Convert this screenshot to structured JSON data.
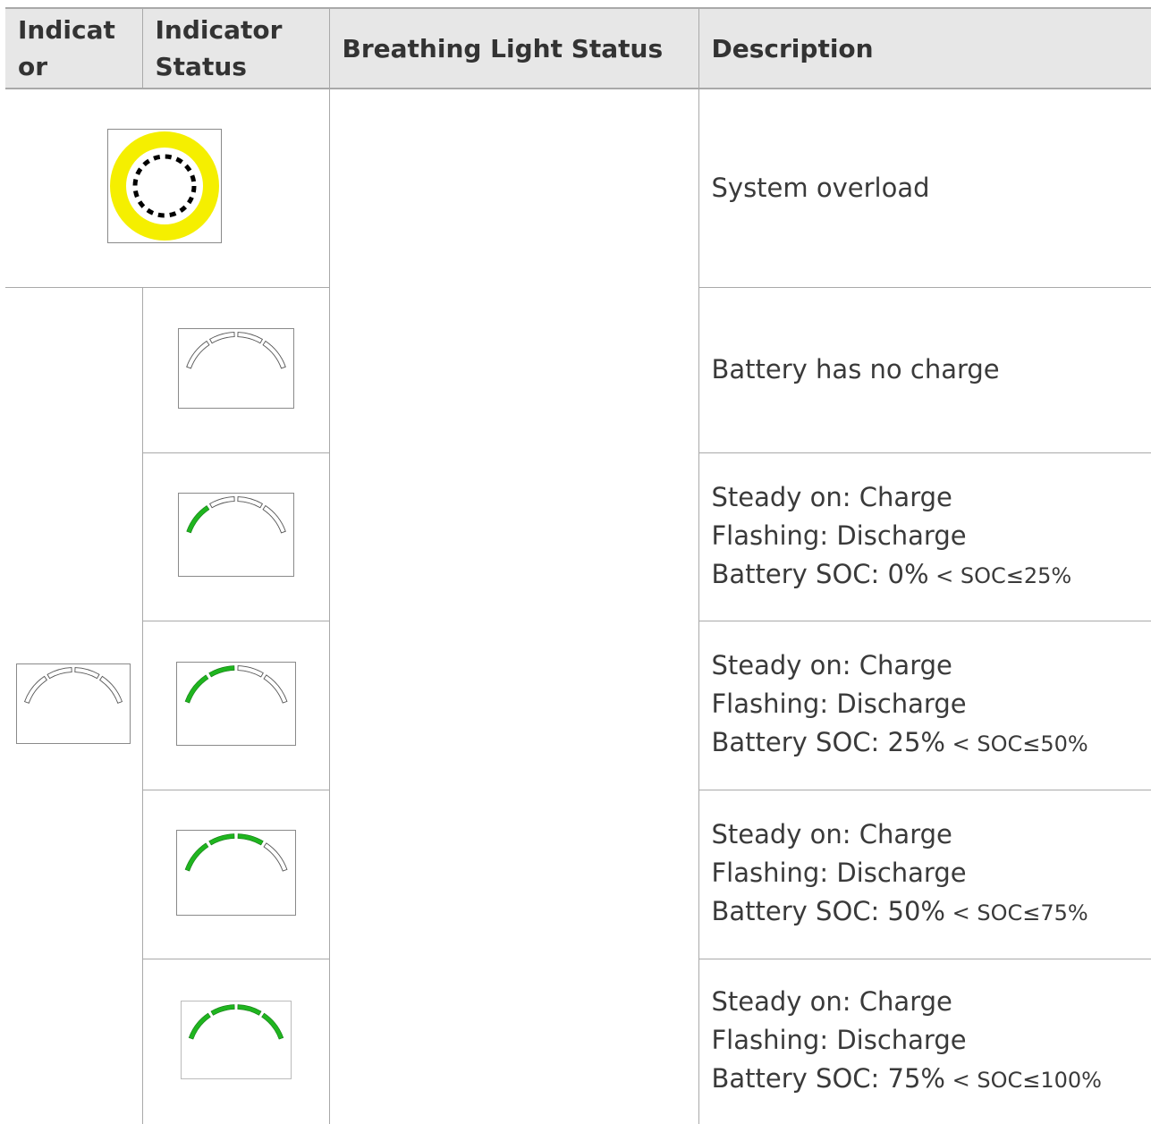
{
  "header": {
    "col1": "Indicat or",
    "col2": "Indicator Status",
    "col3": "Breathing Light Status",
    "col4": "Description"
  },
  "rows": [
    {
      "icon": "overload-ring-icon",
      "colors": {
        "ring": "#f5ef00",
        "dots": "#000000"
      },
      "desc_lines": [
        "System overload"
      ]
    },
    {
      "icon": "battery-arc-0-icon",
      "lit_segments": 0,
      "desc_lines": [
        "Battery has no charge"
      ]
    },
    {
      "icon": "battery-arc-1-icon",
      "lit_segments": 1,
      "desc_lines": [
        "Steady on: Charge",
        "Flashing: Discharge"
      ],
      "soc_prefix": "Battery SOC: 0%",
      "soc_range": " < SOC≤25%"
    },
    {
      "icon": "battery-arc-2-icon",
      "lit_segments": 2,
      "desc_lines": [
        "Steady on: Charge",
        "Flashing: Discharge"
      ],
      "soc_prefix": "Battery SOC: 25%",
      "soc_range": " < SOC≤50%"
    },
    {
      "icon": "battery-arc-3-icon",
      "lit_segments": 3,
      "desc_lines": [
        "Steady on: Charge",
        "Flashing: Discharge"
      ],
      "soc_prefix": "Battery SOC: 50%",
      "soc_range": " < SOC≤75%"
    },
    {
      "icon": "battery-arc-4-icon",
      "lit_segments": 4,
      "desc_lines": [
        "Steady on: Charge",
        "Flashing: Discharge"
      ],
      "soc_prefix": "Battery SOC: 75%",
      "soc_range": " < SOC≤100%"
    }
  ],
  "indicator_icon": "battery-arc-indicator-icon",
  "colors": {
    "lit": "#1fb51f",
    "unlit_fill": "#ffffff",
    "outline": "#555555",
    "header_bg": "#e7e7e7",
    "border": "#a9a9a9"
  }
}
